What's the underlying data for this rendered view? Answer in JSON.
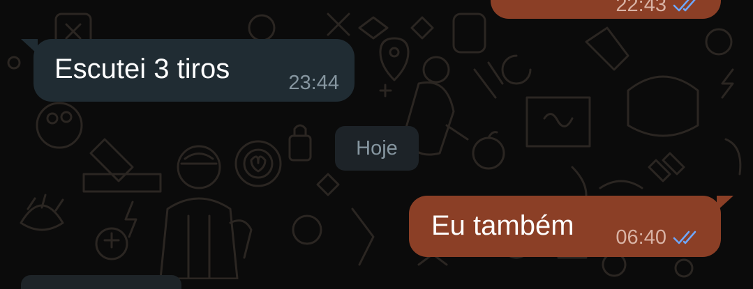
{
  "chat": {
    "messages": [
      {
        "direction": "outgoing",
        "text": "",
        "time": "22:43",
        "status_icon": "double-check-read-icon",
        "partially_visible": true
      },
      {
        "direction": "incoming",
        "text": "Escutei 3 tiros",
        "time": "23:44"
      },
      {
        "direction": "outgoing",
        "text": "Eu também",
        "time": "06:40",
        "status_icon": "double-check-read-icon"
      }
    ],
    "date_separator": "Hoje"
  },
  "colors": {
    "background": "#0b0b0b",
    "incoming_bubble": "#202c33",
    "outgoing_bubble": "#8b3f26",
    "read_tick": "#6ea8ff",
    "timestamp_incoming": "#8696a0",
    "timestamp_outgoing": "#d9b3a5",
    "wallpaper_doodle": "#2a2520"
  }
}
